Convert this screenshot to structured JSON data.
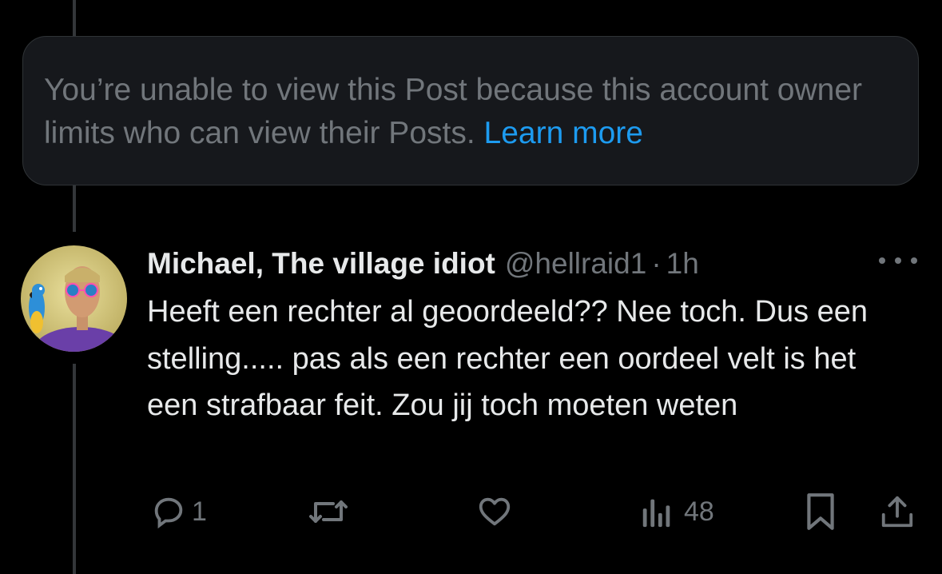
{
  "notice": {
    "text": "You’re unable to view this Post because this account owner limits who can view their Posts. ",
    "link": "Learn more"
  },
  "post": {
    "display_name": "Michael, The village idiot",
    "handle": "@hellraid1",
    "separator": "·",
    "time": "1h",
    "text": "Heeft een rechter al geoordeeld?? Nee toch. Dus een stelling..... pas als een rechter een oordeel velt is het een strafbaar feit. Zou jij toch moeten weten",
    "actions": {
      "reply_count": "1",
      "views_count": "48"
    }
  },
  "icons": [
    "more-icon",
    "reply-icon",
    "repost-icon",
    "like-icon",
    "views-icon",
    "bookmark-icon",
    "share-icon"
  ],
  "colors": {
    "background": "#000000",
    "link": "#1d9bf0",
    "muted": "#71767b",
    "text": "#e7e9ea"
  }
}
